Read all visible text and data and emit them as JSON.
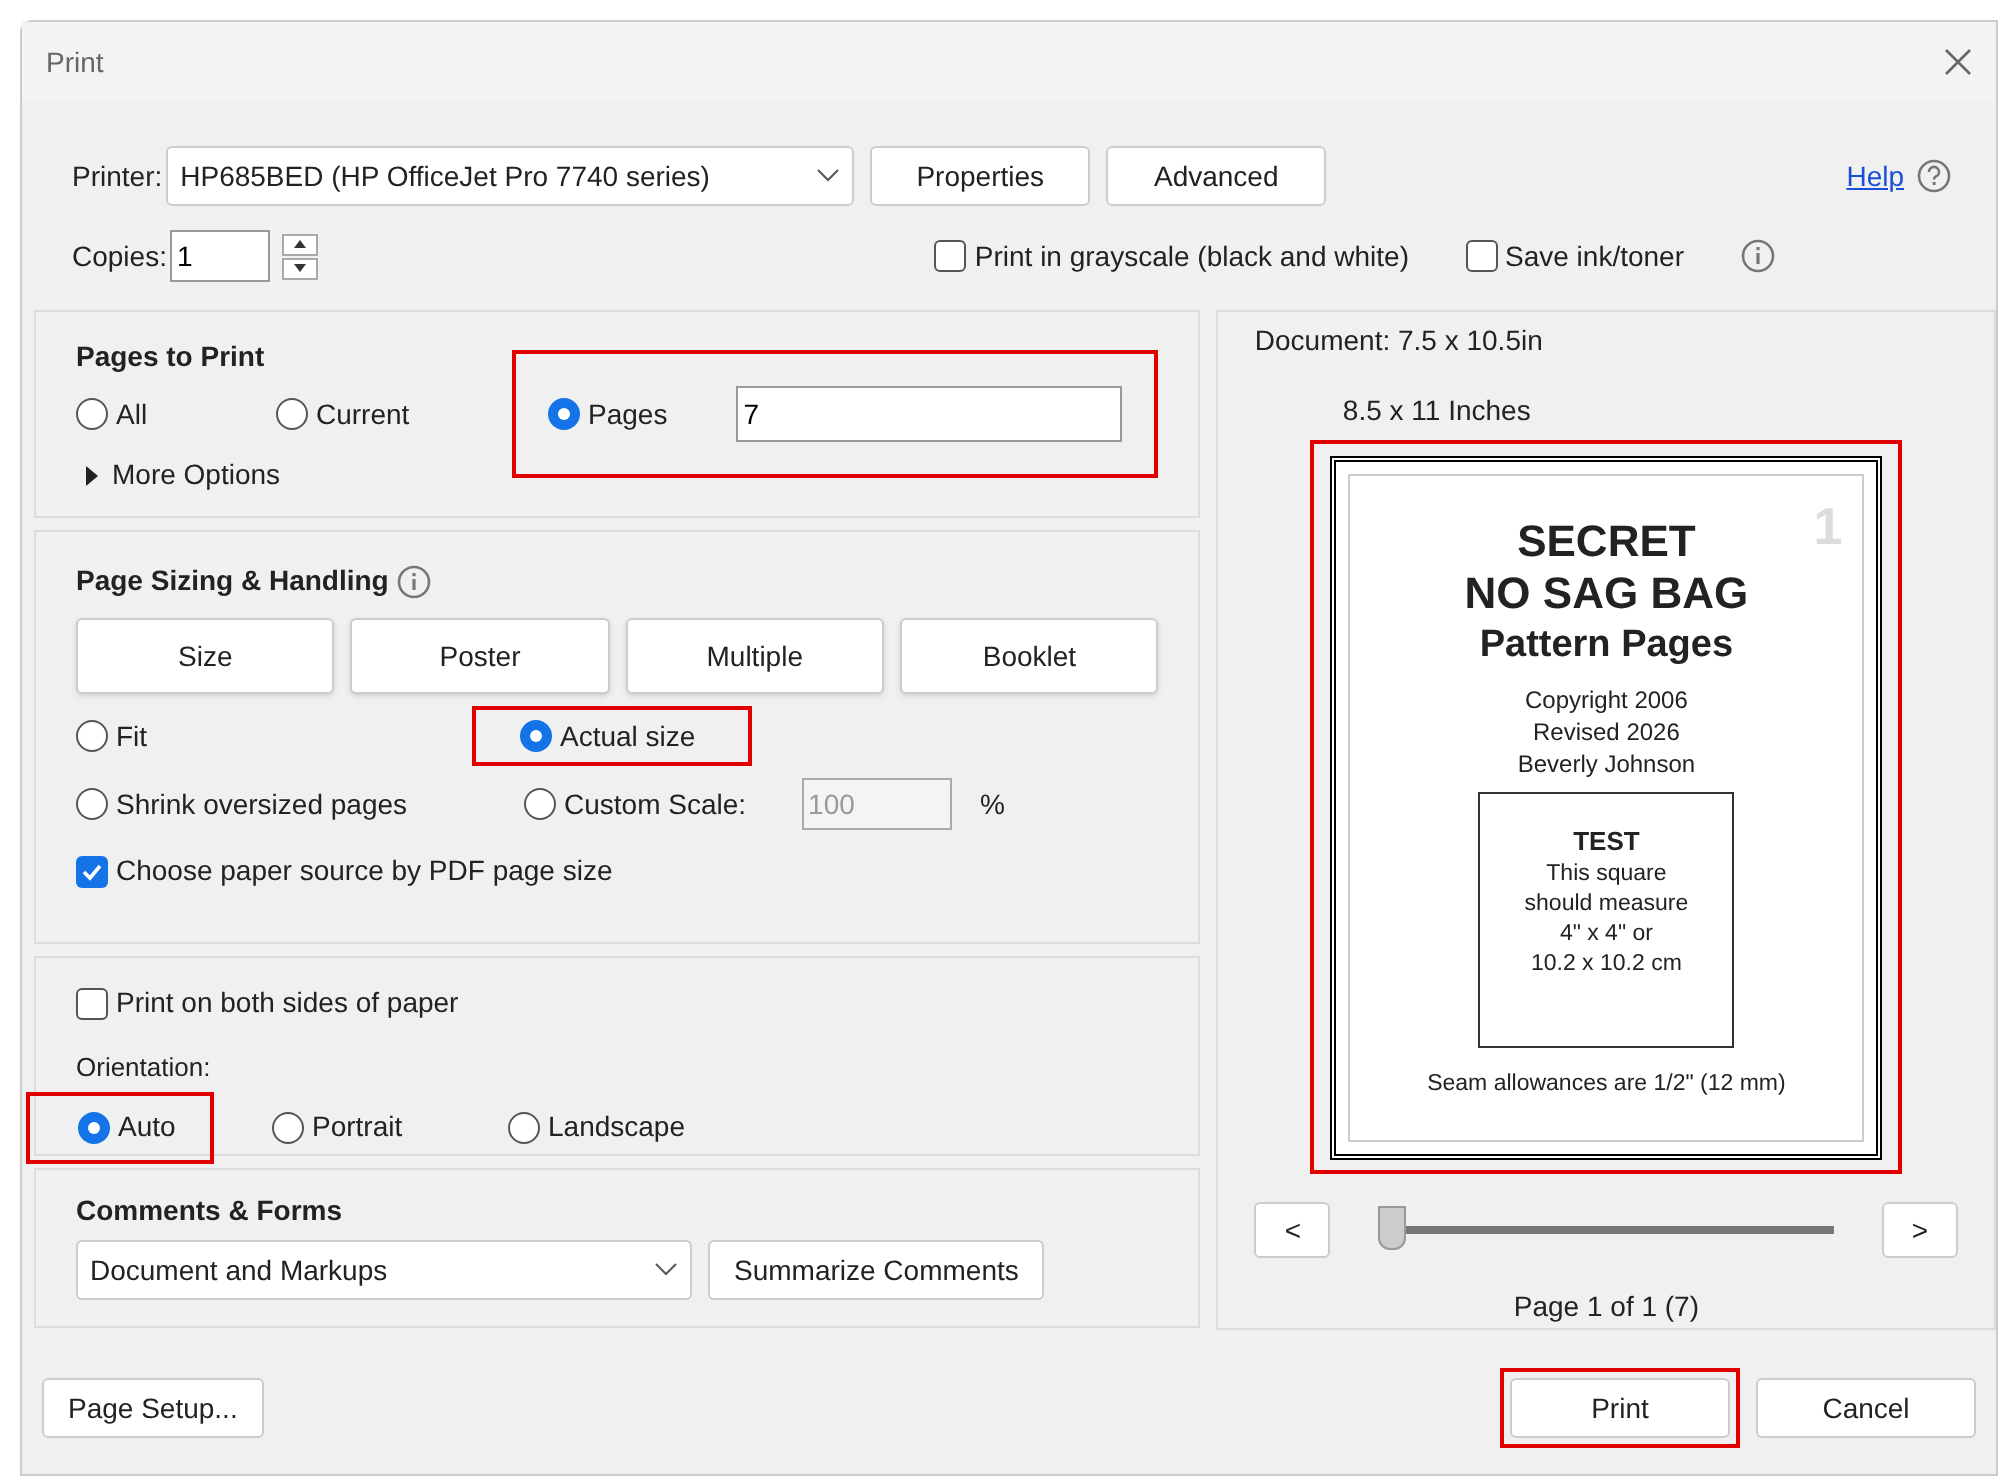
{
  "window": {
    "title": "Print"
  },
  "printer": {
    "label": "Printer:",
    "value": "HP685BED (HP OfficeJet Pro 7740 series)"
  },
  "top_buttons": [
    "Properties",
    "Advanced"
  ],
  "help": {
    "label": "Help"
  },
  "copies": {
    "label": "Copies:",
    "value": "1"
  },
  "print_options": [
    {
      "label": "Print in grayscale (black and white)",
      "checked": false
    },
    {
      "label": "Save ink/toner",
      "checked": false
    }
  ],
  "pages_to_print": {
    "title": "Pages to Print",
    "options": [
      {
        "label": "All",
        "selected": false,
        "highlighted": false
      },
      {
        "label": "Current",
        "selected": false,
        "highlighted": false
      },
      {
        "label": "Pages",
        "selected": true,
        "highlighted": true,
        "value": "7"
      }
    ],
    "more_options": {
      "label": "More Options",
      "expanded": false
    }
  },
  "sizing": {
    "title": "Page Sizing & Handling",
    "modes": [
      "Size",
      "Poster",
      "Multiple",
      "Booklet"
    ],
    "options": [
      {
        "label": "Fit",
        "selected": false,
        "highlighted": false
      },
      {
        "label": "Actual size",
        "selected": true,
        "highlighted": true
      },
      {
        "label": "Shrink oversized pages",
        "selected": false,
        "highlighted": false
      },
      {
        "label": "Custom Scale:",
        "selected": false,
        "highlighted": false,
        "disabled": true,
        "value": "100",
        "unit": "%"
      }
    ],
    "paper_source": {
      "label": "Choose paper source by PDF page size",
      "checked": true
    }
  },
  "duplex": {
    "label": "Print on both sides of paper",
    "checked": false
  },
  "orientation": {
    "label": "Orientation:",
    "options": [
      {
        "label": "Auto",
        "selected": true,
        "highlighted": true
      },
      {
        "label": "Portrait",
        "selected": false,
        "highlighted": false
      },
      {
        "label": "Landscape",
        "selected": false,
        "highlighted": false
      }
    ]
  },
  "comments": {
    "title": "Comments & Forms",
    "value": "Document and Markups",
    "button": "Summarize Comments"
  },
  "preview": {
    "document_size": "Document: 7.5 x 10.5in",
    "paper_size": "8.5 x 11 Inches",
    "highlighted": true,
    "page": {
      "number": "1",
      "title_lines": [
        "SECRET",
        "NO SAG BAG"
      ],
      "subtitle": "Pattern Pages",
      "credits": [
        "Copyright 2006",
        "Revised 2026",
        "Beverly Johnson"
      ],
      "test_title": "TEST",
      "test_lines": [
        "This square",
        "should measure",
        "4\" x 4\" or",
        "10.2 x 10.2 cm"
      ],
      "footer": "Seam allowances are 1/2\" (12 mm)"
    },
    "prev": "<",
    "next": ">",
    "slider": {
      "level": 0
    },
    "page_label": "Page 1 of 1 (7)"
  },
  "footer": {
    "page_setup": "Page Setup...",
    "buttons": [
      {
        "label": "Print",
        "highlighted": true
      },
      {
        "label": "Cancel",
        "highlighted": false
      }
    ]
  }
}
